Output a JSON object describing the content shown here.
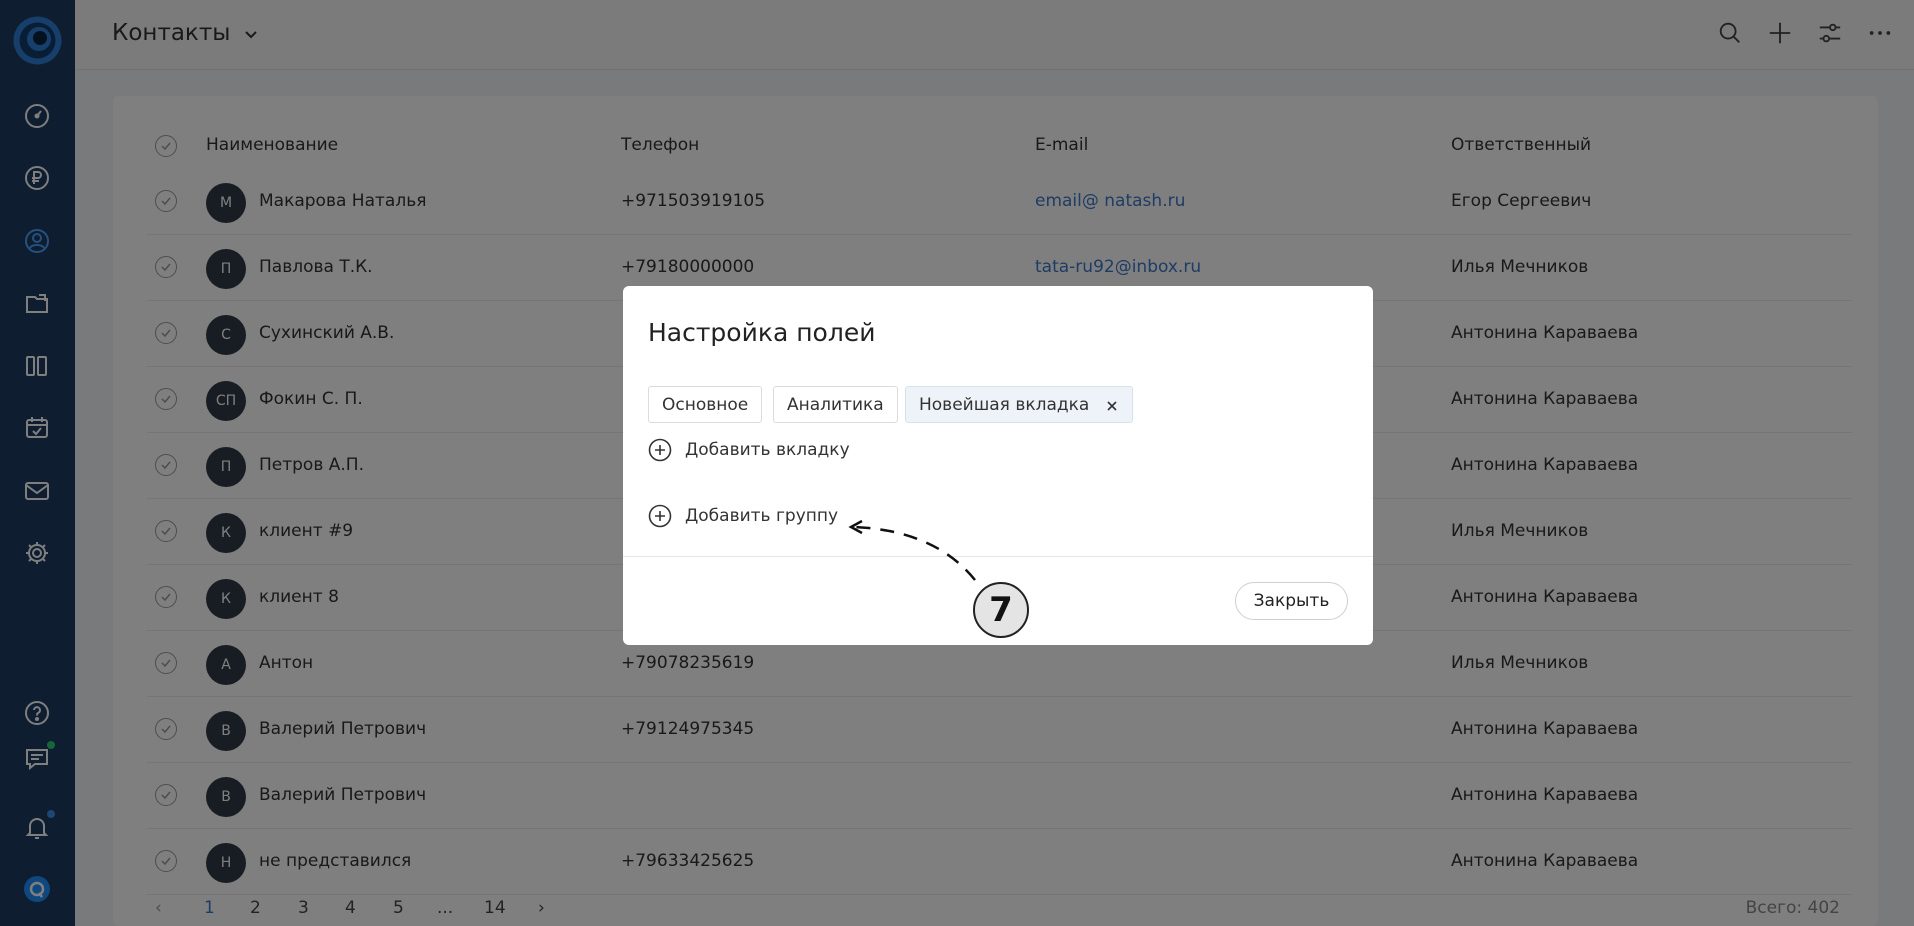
{
  "header": {
    "title": "Контакты",
    "actions": [
      "search-icon",
      "plus-icon",
      "filter-sliders-icon",
      "more-horizontal-icon"
    ]
  },
  "sidebar": {
    "items": [
      {
        "icon": "dashboard-gauge-icon"
      },
      {
        "icon": "ruble-icon"
      },
      {
        "icon": "contacts-user-icon",
        "active": true
      },
      {
        "icon": "folder-check-icon"
      },
      {
        "icon": "kanban-board-icon"
      },
      {
        "icon": "calendar-check-icon"
      },
      {
        "icon": "mail-icon"
      },
      {
        "icon": "settings-gear-icon"
      }
    ],
    "bottom": [
      {
        "icon": "help-question-icon"
      },
      {
        "icon": "chat-icon"
      },
      {
        "icon": "bell-icon"
      },
      {
        "icon": "user-account-icon"
      }
    ]
  },
  "table": {
    "columns": [
      "Наименование",
      "Телефон",
      "E-mail",
      "Ответственный"
    ],
    "rows": [
      {
        "initials": "М",
        "name": "Макарова Наталья",
        "phone": "+971503919105",
        "email": "email@ natash.ru",
        "resp": "Егор Сергеевич"
      },
      {
        "initials": "П",
        "name": "Павлова Т.К.",
        "phone": "+79180000000",
        "email": "tata-ru92@inbox.ru",
        "resp": "Илья Мечников"
      },
      {
        "initials": "С",
        "name": "Сухинский А.В.",
        "phone": "",
        "email": "",
        "resp": "Антонина Караваева"
      },
      {
        "initials": "СП",
        "name": "Фокин С. П.",
        "phone": "",
        "email": "",
        "resp": "Антонина Караваева"
      },
      {
        "initials": "П",
        "name": "Петров А.П.",
        "phone": "",
        "email": "",
        "resp": "Антонина Караваева"
      },
      {
        "initials": "К",
        "name": "клиент #9",
        "phone": "",
        "email": "",
        "resp": "Илья Мечников"
      },
      {
        "initials": "К",
        "name": "клиент 8",
        "phone": "",
        "email": "",
        "resp": "Антонина Караваева"
      },
      {
        "initials": "А",
        "name": "Антон",
        "phone": "+79078235619",
        "email": "",
        "resp": "Илья Мечников"
      },
      {
        "initials": "В",
        "name": "Валерий Петрович",
        "phone": "+79124975345",
        "email": "",
        "resp": "Антонина Караваева"
      },
      {
        "initials": "В",
        "name": "Валерий Петрович",
        "phone": "",
        "email": "",
        "resp": "Антонина Караваева"
      },
      {
        "initials": "Н",
        "name": "не представился",
        "phone": "+79633425625",
        "email": "",
        "resp": "Антонина Караваева"
      }
    ]
  },
  "pagination": {
    "pages": [
      "1",
      "2",
      "3",
      "4",
      "5",
      "...",
      "14"
    ],
    "current": "1",
    "total": "Всего: 402"
  },
  "modal": {
    "title": "Настройка полей",
    "tabs": [
      {
        "label": "Основное"
      },
      {
        "label": "Аналитика"
      },
      {
        "label": "Новейшая вкладка",
        "active": true
      }
    ],
    "add_tab": "Добавить вкладку",
    "add_group": "Добавить группу",
    "close": "Закрыть"
  },
  "callout": {
    "number": "7"
  },
  "colors": {
    "sidebar": "#1c3a5e",
    "accent": "#3c78c8",
    "avatar": "#313a46",
    "notification_green": "#2ecc71",
    "notification_blue": "#3b8ef0"
  }
}
